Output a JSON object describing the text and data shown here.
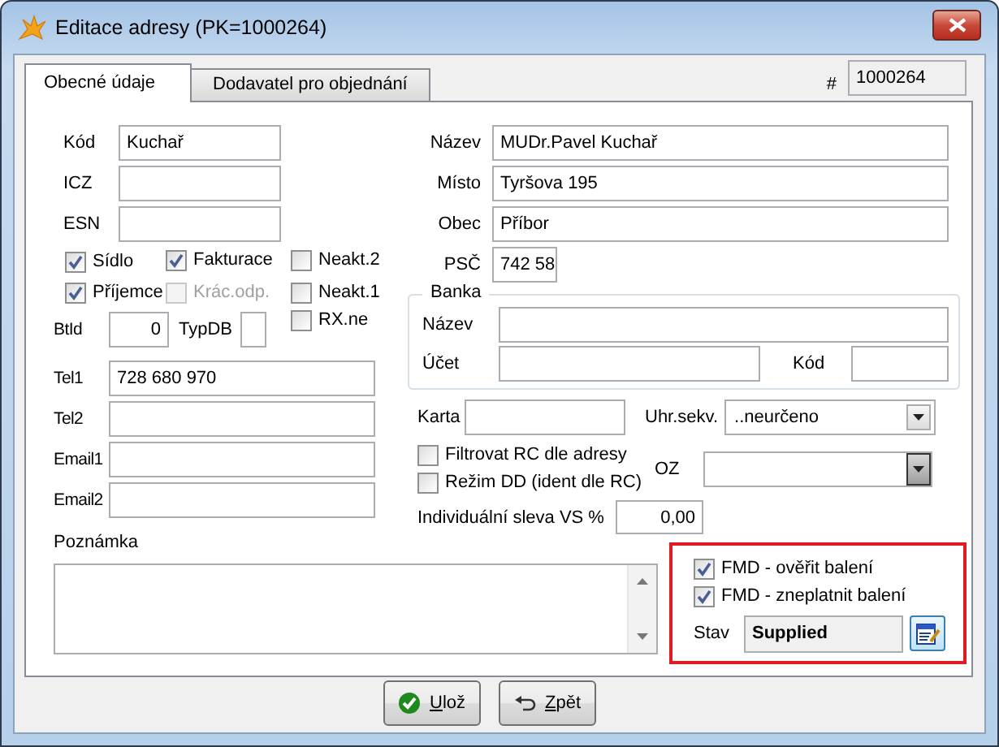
{
  "window": {
    "title": "Editace adresy (PK=1000264)"
  },
  "tabs": [
    {
      "label": "Obecné údaje",
      "selected": true
    },
    {
      "label": "Dodavatel pro objednání",
      "selected": false
    }
  ],
  "record_id": {
    "label": "#",
    "value": "1000264"
  },
  "left_fields": [
    {
      "label": "Kód",
      "value": "Kuchař"
    },
    {
      "label": "ICZ"
    },
    {
      "label": "ESN"
    }
  ],
  "flags": [
    {
      "label": "Sídlo",
      "checked": true,
      "disabled": false
    },
    {
      "label": "Fakturace",
      "checked": true,
      "disabled": false
    },
    {
      "label": "Neakt.2",
      "checked": false,
      "disabled": false
    },
    {
      "label": "Příjemce",
      "checked": true,
      "disabled": false
    },
    {
      "label": "Krác.odp.",
      "checked": false,
      "disabled": true
    },
    {
      "label": "Neakt.1",
      "checked": false,
      "disabled": false
    }
  ],
  "btid": {
    "label": "BtId",
    "value": "0"
  },
  "typdb": {
    "label": "TypDB"
  },
  "rx_ne": {
    "label": "RX.ne",
    "checked": false
  },
  "contact_fields": [
    {
      "label": "Tel1",
      "value": "728 680 970"
    },
    {
      "label": "Tel2"
    },
    {
      "label": "Email1"
    },
    {
      "label": "Email2"
    }
  ],
  "address_fields": [
    {
      "label": "Název",
      "value": "MUDr.Pavel Kuchař",
      "kind": "wide"
    },
    {
      "label": "Místo",
      "value": "Tyršova 195",
      "kind": "wide"
    },
    {
      "label": "Obec",
      "value": "Příbor",
      "kind": "wide"
    },
    {
      "label": "PSČ",
      "value": "742 58",
      "kind": "short"
    }
  ],
  "bank": {
    "title": "Banka",
    "name": {
      "label": "Název"
    },
    "account": {
      "label": "Účet"
    },
    "code": {
      "label": "Kód"
    }
  },
  "card": {
    "label": "Karta"
  },
  "payment_sequence": {
    "label": "Uhr.sekv.",
    "value": "..neurčeno"
  },
  "oz": {
    "label": "OZ"
  },
  "options": [
    {
      "label": "Filtrovat RC dle adresy",
      "checked": false
    },
    {
      "label": "Režim DD (ident dle RC)",
      "checked": false
    }
  ],
  "discount": {
    "label": "Individuální sleva VS %",
    "value": "0,00"
  },
  "note": {
    "label": "Poznámka"
  },
  "fmd": {
    "options": [
      {
        "label": "FMD - ověřit balení",
        "checked": true
      },
      {
        "label": "FMD - zneplatnit balení",
        "checked": true
      }
    ],
    "status": {
      "label": "Stav",
      "value": "Supplied"
    }
  },
  "buttons": [
    {
      "label": "Ulož",
      "kind": "save"
    },
    {
      "label": "Zpět",
      "kind": "back"
    }
  ]
}
